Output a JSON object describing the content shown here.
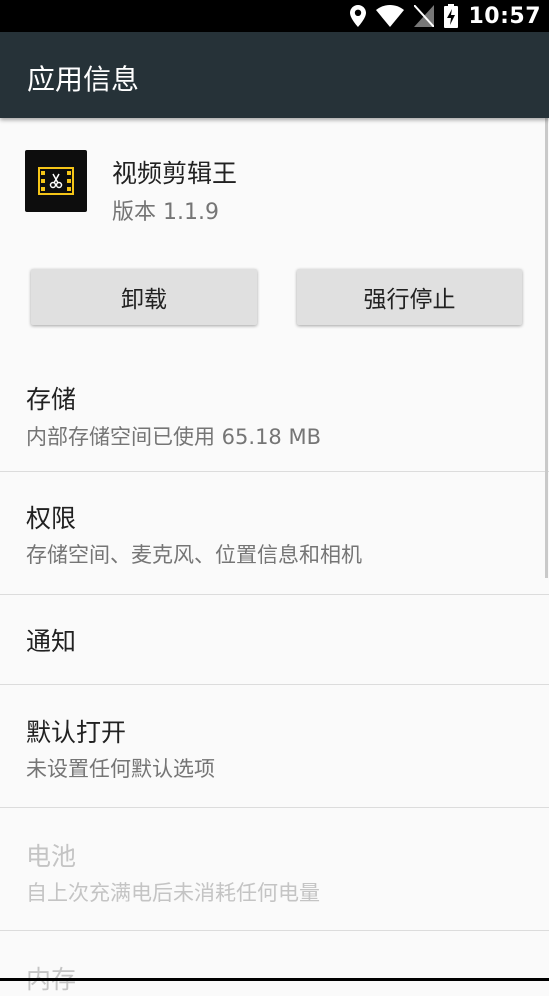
{
  "status_bar": {
    "time": "10:57",
    "icons": [
      "location-icon",
      "wifi-icon",
      "no-sim-icon",
      "battery-charging-icon"
    ]
  },
  "app_bar": {
    "title": "应用信息"
  },
  "app": {
    "name": "视频剪辑王",
    "version": "版本 1.1.9",
    "icon": "film-scissors-icon"
  },
  "buttons": {
    "uninstall": "卸载",
    "force_stop": "强行停止"
  },
  "settings": [
    {
      "label": "存储",
      "summary": "内部存储空间已使用 65.18 MB",
      "enabled": true
    },
    {
      "label": "权限",
      "summary": "存储空间、麦克风、位置信息和相机",
      "enabled": true
    },
    {
      "label": "通知",
      "summary": "",
      "enabled": true
    },
    {
      "label": "默认打开",
      "summary": "未设置任何默认选项",
      "enabled": true
    },
    {
      "label": "电池",
      "summary": "自上次充满电后未消耗任何电量",
      "enabled": false
    },
    {
      "label": "内存",
      "summary": "",
      "enabled": false
    }
  ],
  "colors": {
    "app_bar": "#263238",
    "status_bar": "#000000",
    "background": "#fafafa",
    "button": "#e0e0e0",
    "disabled_text": "#c4c4c4",
    "icon_accent": "#f5c518"
  }
}
